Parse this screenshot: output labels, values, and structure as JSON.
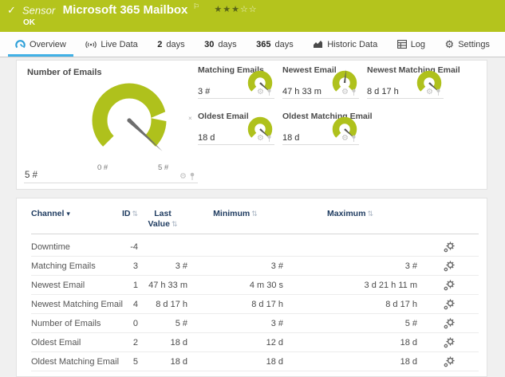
{
  "header": {
    "check": "✓",
    "kind": "Sensor",
    "title": "Microsoft 365 Mailbox",
    "flag": "⚐",
    "stars_filled": "★★★",
    "stars_empty": "☆☆",
    "status": "OK"
  },
  "tabs": [
    {
      "label": "Overview",
      "active": true
    },
    {
      "label": "Live Data"
    },
    {
      "num": "2",
      "label": "days"
    },
    {
      "num": "30",
      "label": "days"
    },
    {
      "num": "365",
      "label": "days"
    },
    {
      "label": "Historic Data"
    },
    {
      "label": "Log"
    },
    {
      "label": "Settings"
    }
  ],
  "icons": {
    "gear": "⚙",
    "sort": "⇅",
    "filter": "▾",
    "marker": "×"
  },
  "gauges": {
    "main": {
      "title": "Number of Emails",
      "value": "5 #",
      "scale_min": "0 #",
      "scale_max": "5 #"
    },
    "small": [
      {
        "title": "Matching Emails",
        "value": "3 #"
      },
      {
        "title": "Newest Email",
        "value": "47 h 33 m"
      },
      {
        "title": "Newest Matching Email",
        "value": "8 d 17 h"
      },
      {
        "title": "Oldest Email",
        "value": "18 d"
      },
      {
        "title": "Oldest Matching Email",
        "value": "18 d"
      }
    ]
  },
  "table": {
    "headers": {
      "channel": "Channel",
      "id": "ID",
      "last1": "Last",
      "last2": "Value",
      "min": "Minimum",
      "max": "Maximum"
    },
    "rows": [
      {
        "channel": "Downtime",
        "id": "-4",
        "last": "",
        "min": "",
        "max": ""
      },
      {
        "channel": "Matching Emails",
        "id": "3",
        "last": "3 #",
        "min": "3 #",
        "max": "3 #"
      },
      {
        "channel": "Newest Email",
        "id": "1",
        "last": "47 h 33 m",
        "min": "4 m 30 s",
        "max": "3 d 21 h 11 m"
      },
      {
        "channel": "Newest Matching Email",
        "id": "4",
        "last": "8 d 17 h",
        "min": "8 d 17 h",
        "max": "8 d 17 h"
      },
      {
        "channel": "Number of Emails",
        "id": "0",
        "last": "5 #",
        "min": "3 #",
        "max": "5 #"
      },
      {
        "channel": "Oldest Email",
        "id": "2",
        "last": "18 d",
        "min": "12 d",
        "max": "18 d"
      },
      {
        "channel": "Oldest Matching Email",
        "id": "5",
        "last": "18 d",
        "min": "18 d",
        "max": "18 d"
      }
    ]
  },
  "colors": {
    "status_green": "#b4c41d",
    "gauge_green": "#afc11c",
    "active_tab_blue": "#41b1e6",
    "header_navy": "#1d3a5f"
  }
}
